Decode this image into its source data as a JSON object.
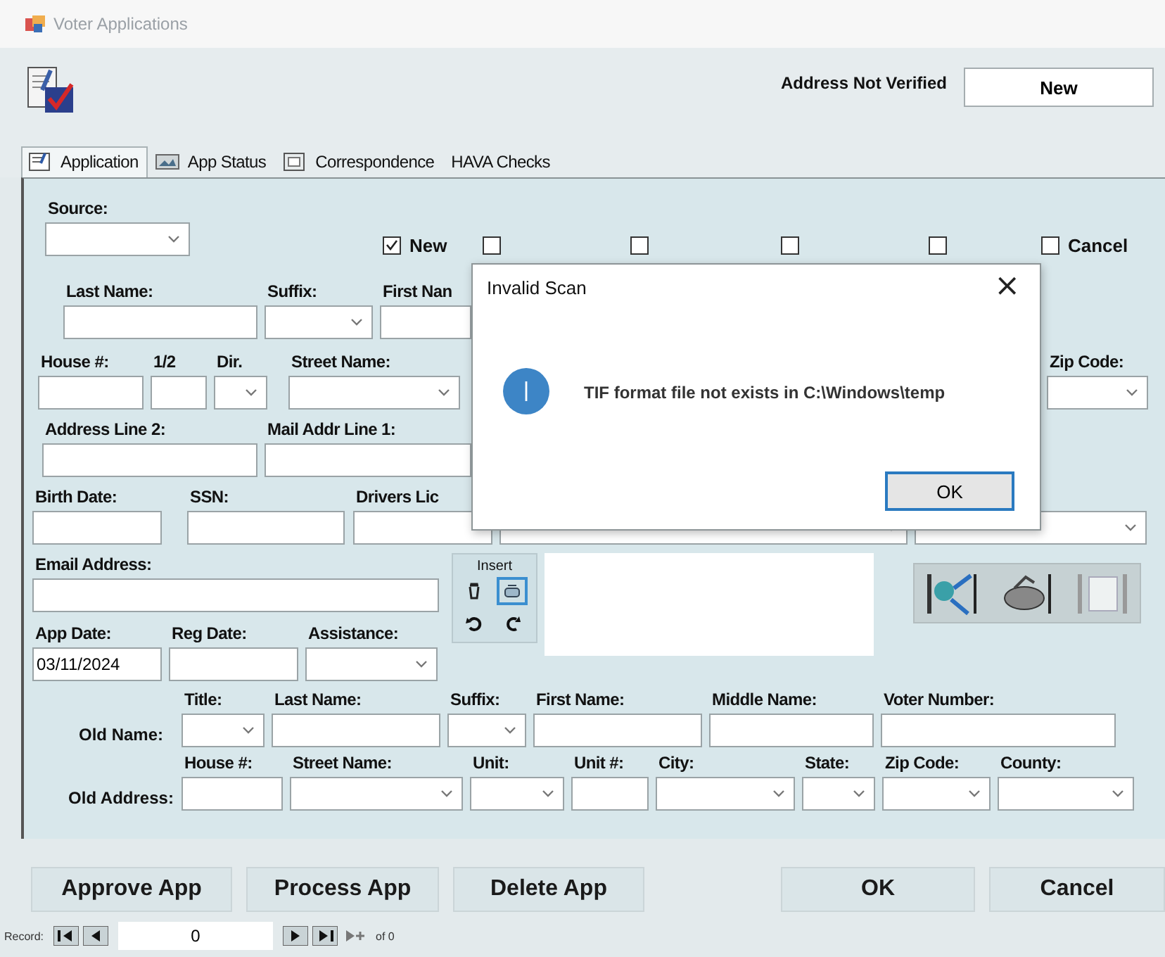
{
  "window": {
    "title": "Voter Applications"
  },
  "header": {
    "address_status": "Address Not Verified",
    "app_status": "New"
  },
  "tabs": [
    {
      "label": "Application",
      "selected": true
    },
    {
      "label": "App Status",
      "selected": false
    },
    {
      "label": "Correspondence",
      "selected": false
    },
    {
      "label": "HAVA Checks",
      "selected": false
    }
  ],
  "form": {
    "source": {
      "label": "Source:",
      "kind": "dropdown"
    },
    "checkboxes": [
      {
        "label": "New",
        "checked": true
      },
      {
        "checked": false
      },
      {
        "checked": false
      },
      {
        "checked": false
      },
      {
        "checked": false
      },
      {
        "label": "Cancel",
        "checked": false
      }
    ],
    "rows": [
      [
        {
          "label": "Last Name:",
          "kind": "text"
        },
        {
          "label": "Suffix:",
          "kind": "dropdown"
        },
        {
          "label": "First Nan",
          "kind": "text"
        }
      ],
      [
        {
          "label": "House #:",
          "kind": "text"
        },
        {
          "label": "1/2",
          "kind": "text"
        },
        {
          "label": "Dir.",
          "kind": "dropdown"
        },
        {
          "label": "Street Name:",
          "kind": "dropdown"
        },
        {
          "label": "Zip Code:",
          "kind": "dropdown"
        }
      ],
      [
        {
          "label": "Address Line 2:",
          "kind": "text"
        },
        {
          "label": "Mail Addr Line 1:",
          "kind": "text"
        }
      ],
      [
        {
          "label": "Birth Date:",
          "kind": "text"
        },
        {
          "label": "SSN:",
          "kind": "text"
        },
        {
          "label": "Drivers Lic",
          "kind": "text"
        },
        {
          "kind": "dropdown"
        },
        {
          "kind": "dropdown"
        }
      ],
      [
        {
          "label": "Email Address:",
          "kind": "text"
        }
      ],
      [
        {
          "label": "App Date:",
          "kind": "text",
          "value": "03/11/2024"
        },
        {
          "label": "Reg Date:",
          "kind": "text"
        },
        {
          "label": "Assistance:",
          "kind": "dropdown"
        }
      ]
    ],
    "insert": {
      "label": "Insert"
    },
    "old_name": {
      "label": "Old Name:",
      "fields": [
        {
          "label": "Title:",
          "kind": "dropdown"
        },
        {
          "label": "Last Name:",
          "kind": "text"
        },
        {
          "label": "Suffix:",
          "kind": "dropdown"
        },
        {
          "label": "First Name:",
          "kind": "text"
        },
        {
          "label": "Middle Name:",
          "kind": "text"
        },
        {
          "label": "Voter Number:",
          "kind": "text"
        }
      ]
    },
    "old_address": {
      "label": "Old Address:",
      "fields": [
        {
          "label": "House #:",
          "kind": "text"
        },
        {
          "label": "Street Name:",
          "kind": "dropdown"
        },
        {
          "label": "Unit:",
          "kind": "dropdown"
        },
        {
          "label": "Unit #:",
          "kind": "text"
        },
        {
          "label": "City:",
          "kind": "dropdown"
        },
        {
          "label": "State:",
          "kind": "dropdown"
        },
        {
          "label": "Zip Code:",
          "kind": "dropdown"
        },
        {
          "label": "County:",
          "kind": "dropdown"
        }
      ]
    }
  },
  "dialog": {
    "title": "Invalid Scan",
    "close": "×",
    "message": "TIF format file not exists in C:\\Windows\\temp",
    "button": "OK"
  },
  "buttons": [
    "Approve App",
    "Process App",
    "Delete App",
    "OK",
    "Cancel"
  ],
  "record_nav": {
    "label": "Record:",
    "value": "0",
    "total": "of 0"
  }
}
